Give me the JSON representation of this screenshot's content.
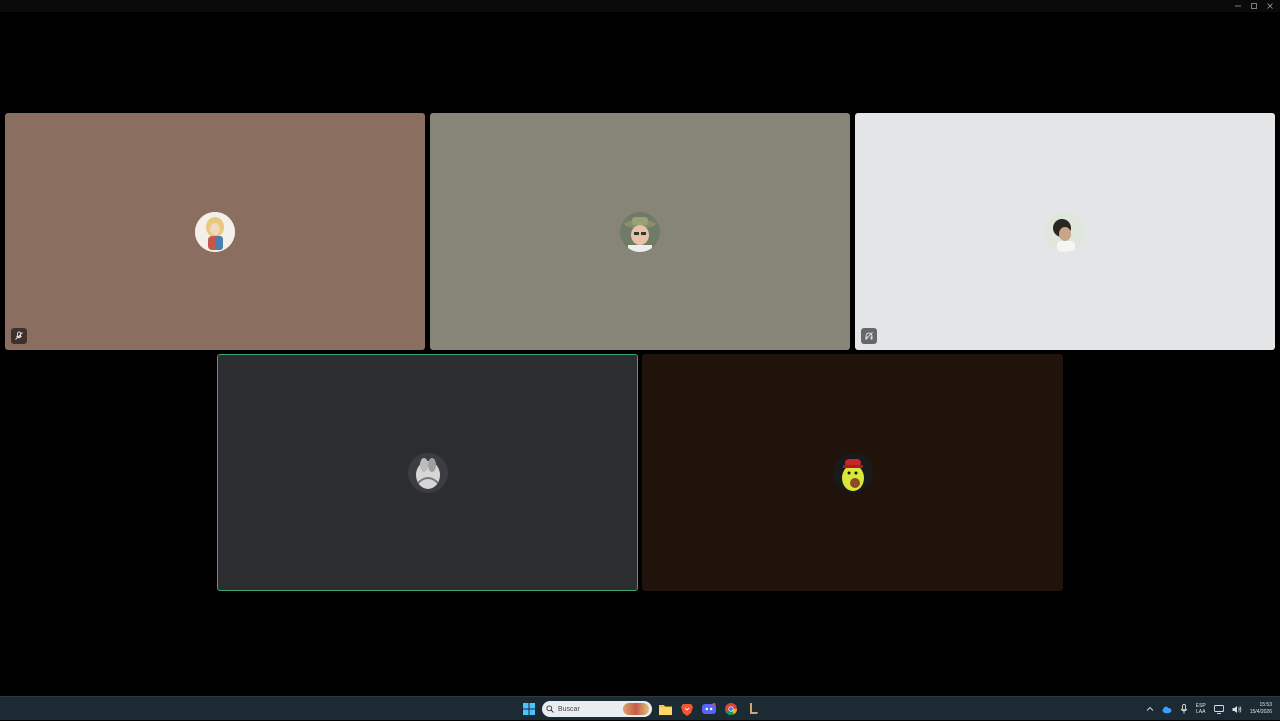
{
  "window": {
    "controls": {
      "minimize_icon": "minimize-icon",
      "maximize_icon": "maximize-icon",
      "close_icon": "close-icon"
    }
  },
  "participants": [
    {
      "tile_color": "#8a6e5f",
      "avatar": "blonde-character-avatar",
      "status_icon": "mic-muted-icon"
    },
    {
      "tile_color": "#878478",
      "avatar": "man-with-hat-avatar",
      "status_icon": ""
    },
    {
      "tile_color": "#e3e5e6",
      "avatar": "person-photo-avatar",
      "status_icon": "deafened-icon"
    },
    {
      "tile_color": "#2c2d31",
      "avatar": "grey-figure-avatar",
      "status_icon": "",
      "speaking": true
    },
    {
      "tile_color": "#1f130b",
      "avatar": "cartoon-avocado-avatar",
      "status_icon": ""
    }
  ],
  "taskbar": {
    "search_placeholder": "Buscar",
    "pinned_apps": [
      "windows-start-icon",
      "search-icon",
      "file-explorer-icon",
      "brave-browser-icon",
      "discord-icon",
      "chrome-icon",
      "league-client-icon"
    ],
    "tray": {
      "lang_primary": "ESP",
      "lang_secondary": "LAA",
      "time": "15:53",
      "date": "15/4/2026"
    }
  },
  "colors": {
    "speaking_border": "#3fa56b",
    "taskbar_bg": "#1c2a33"
  }
}
